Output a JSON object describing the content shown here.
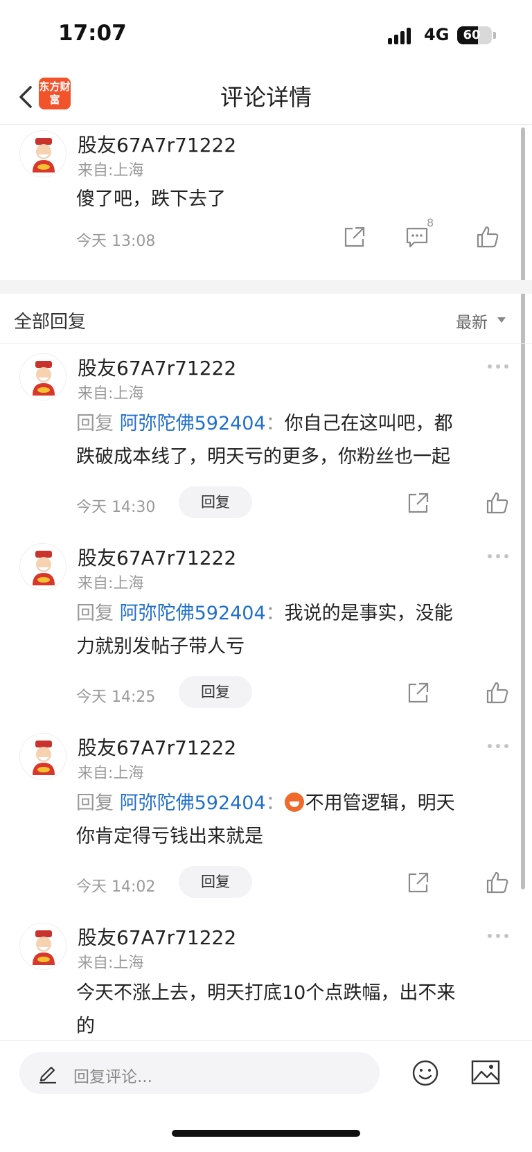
{
  "status_bar": {
    "time": "17:07",
    "network": "4G",
    "battery": "60",
    "battery_level": 0.6
  },
  "nav": {
    "title": "评论详情",
    "logo_text": "东方财富"
  },
  "main_comment": {
    "username": "股友67A7r71222",
    "location": "来自:上海",
    "text": "傻了吧，跌下去了",
    "time": "今天 13:08",
    "comment_count": "8"
  },
  "section": {
    "title": "全部回复",
    "sort": "最新"
  },
  "replies": [
    {
      "username": "股友67A7r71222",
      "location": "来自:上海",
      "prefix": "回复",
      "target": "阿弥陀佛592404",
      "colon": "：",
      "line1": "你自己在这叫吧，都",
      "line2": "跌破成本线了，明天亏的更多，你粉丝也一起",
      "time": "今天 14:30",
      "reply_label": "回复"
    },
    {
      "username": "股友67A7r71222",
      "location": "来自:上海",
      "prefix": "回复",
      "target": "阿弥陀佛592404",
      "colon": "：",
      "line1": "我说的是事实，没能",
      "line2": "力就别发帖子带人亏",
      "time": "今天 14:25",
      "reply_label": "回复"
    },
    {
      "username": "股友67A7r71222",
      "location": "来自:上海",
      "prefix": "回复",
      "target": "阿弥陀佛592404",
      "colon": "：",
      "line1": "不用管逻辑，明天",
      "line2": "你肯定得亏钱出来就是",
      "time": "今天 14:02",
      "reply_label": "回复"
    },
    {
      "username": "股友67A7r71222",
      "location": "来自:上海",
      "line1": "今天不涨上去，明天打底10个点跌幅，出不来",
      "line2": "的"
    }
  ],
  "bottom_bar": {
    "placeholder": "回复评论..."
  },
  "icons": {
    "back": "back-icon",
    "share": "share-icon",
    "comment": "comment-icon",
    "like": "thumbs-up-icon",
    "more": "more-icon",
    "pen": "pen-icon",
    "emoji": "emoji-icon",
    "image": "image-icon"
  },
  "colors": {
    "link": "#1f6fcc",
    "logo": "#f2532a",
    "muted": "#999999"
  }
}
